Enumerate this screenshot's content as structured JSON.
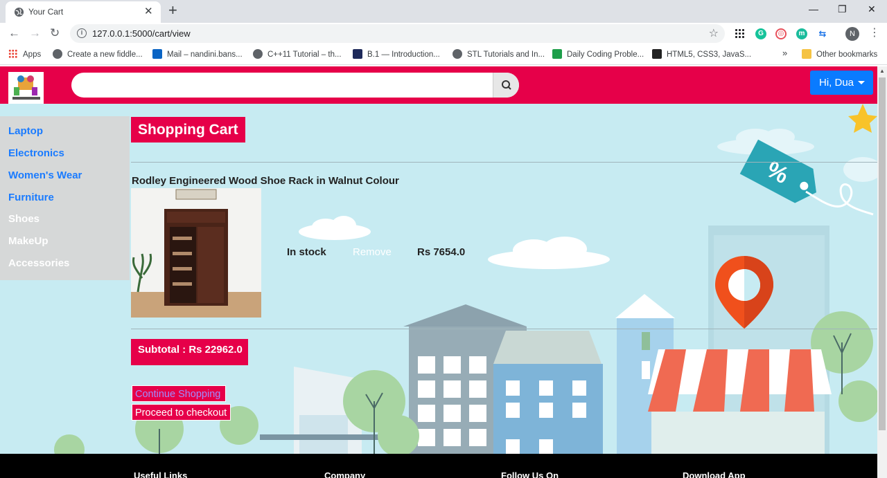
{
  "browser": {
    "tab_title": "Your Cart",
    "url": "127.0.0.1:5000/cart/view",
    "profile_initial": "N",
    "bookmarks": [
      {
        "label": "Apps"
      },
      {
        "label": "Create a new fiddle..."
      },
      {
        "label": "Mail – nandini.bans..."
      },
      {
        "label": "C++11 Tutorial – th..."
      },
      {
        "label": "B.1 — Introduction..."
      },
      {
        "label": "STL Tutorials and In..."
      },
      {
        "label": "Daily Coding Proble..."
      },
      {
        "label": "HTML5, CSS3, JavaS..."
      }
    ],
    "more_bookmarks": "»",
    "other_bookmarks": "Other bookmarks"
  },
  "navbar": {
    "search_value": "",
    "user_label": "Hi, Dua",
    "brand_color": "#e60049",
    "user_button_color": "#0a7bff"
  },
  "sidebar": {
    "items": [
      {
        "label": "Laptop"
      },
      {
        "label": "Electronics"
      },
      {
        "label": "Women's Wear"
      },
      {
        "label": "Furniture"
      },
      {
        "label": "Shoes"
      },
      {
        "label": "MakeUp"
      },
      {
        "label": "Accessories"
      }
    ]
  },
  "cart": {
    "title": "Shopping Cart",
    "items": [
      {
        "name": "Rodley Engineered Wood Shoe Rack in Walnut Colour",
        "stock": "In stock",
        "remove_label": "Remove",
        "price": "Rs 7654.0"
      }
    ],
    "subtotal": "Subtotal : Rs 22962.0",
    "continue_label": "Continue Shopping",
    "checkout_label": "Proceed to checkout"
  },
  "footer": {
    "headings": [
      "Useful Links",
      "Company",
      "Follow Us On",
      "Download App"
    ]
  }
}
